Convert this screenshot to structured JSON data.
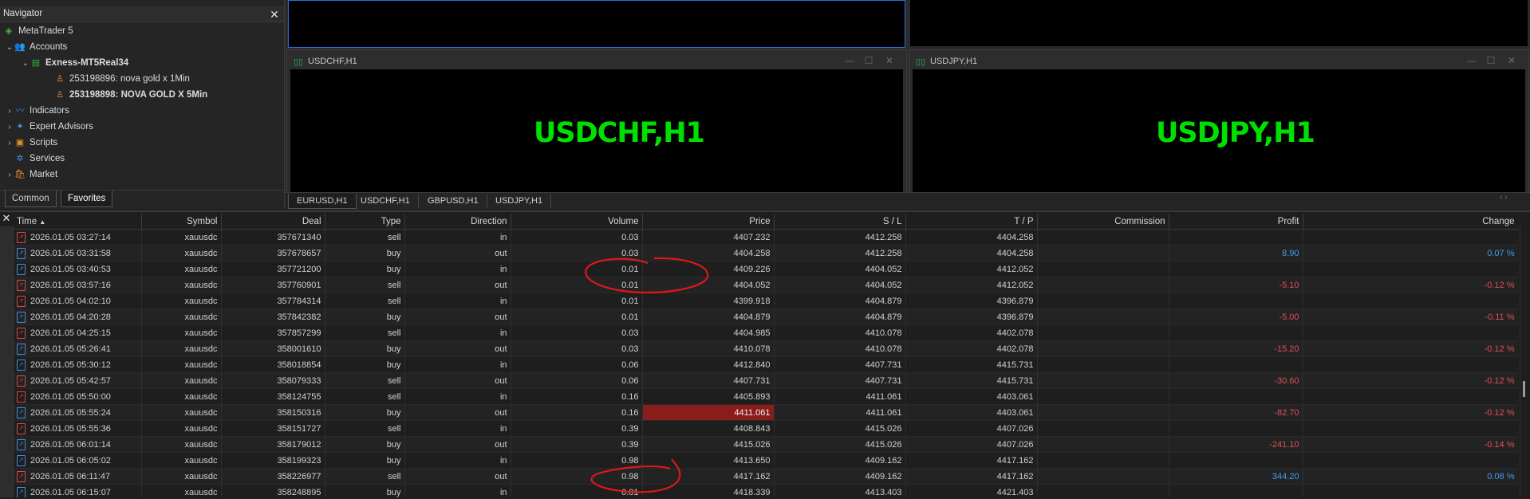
{
  "navigator": {
    "title": "Navigator",
    "items": [
      {
        "label": "MetaTrader 5",
        "icon": "metatrader-icon"
      },
      {
        "label": "Accounts",
        "icon": "accounts-icon"
      },
      {
        "label": "Exness-MT5Real34",
        "icon": "server-icon"
      },
      {
        "label": "253198896: nova gold x 1Min",
        "icon": "user-icon"
      },
      {
        "label": "253198898: NOVA GOLD X 5Min",
        "icon": "user-icon"
      },
      {
        "label": "Indicators",
        "icon": "indicators-icon"
      },
      {
        "label": "Expert Advisors",
        "icon": "expert-advisors-icon"
      },
      {
        "label": "Scripts",
        "icon": "scripts-icon"
      },
      {
        "label": "Services",
        "icon": "services-icon"
      },
      {
        "label": "Market",
        "icon": "market-icon"
      }
    ],
    "tabs": [
      "Common",
      "Favorites"
    ]
  },
  "charts": {
    "windows": [
      {
        "title": "USDCHF,H1",
        "label": "USDCHF,H1"
      },
      {
        "title": "USDJPY,H1",
        "label": "USDJPY,H1"
      }
    ],
    "tabs": [
      "EURUSD,H1",
      "USDCHF,H1",
      "GBPUSD,H1",
      "USDJPY,H1"
    ]
  },
  "deals": {
    "columns": [
      "Time",
      "Symbol",
      "Deal",
      "Type",
      "Direction",
      "Volume",
      "Price",
      "S / L",
      "T / P",
      "Commission",
      "Profit",
      "Change"
    ],
    "rows": [
      {
        "time": "2026.01.05 03:27:14",
        "symbol": "xauusdc",
        "deal": "357671340",
        "type": "sell",
        "direction": "in",
        "volume": "0.03",
        "price": "4407.232",
        "sl": "4412.258",
        "tp": "4404.258",
        "commission": "",
        "profit": "",
        "change": ""
      },
      {
        "time": "2026.01.05 03:31:58",
        "symbol": "xauusdc",
        "deal": "357678657",
        "type": "buy",
        "direction": "out",
        "volume": "0.03",
        "price": "4404.258",
        "sl": "4412.258",
        "tp": "4404.258",
        "commission": "",
        "profit": "8.90",
        "change": "0.07 %"
      },
      {
        "time": "2026.01.05 03:40:53",
        "symbol": "xauusdc",
        "deal": "357721200",
        "type": "buy",
        "direction": "in",
        "volume": "0.01",
        "price": "4409.226",
        "sl": "4404.052",
        "tp": "4412.052",
        "commission": "",
        "profit": "",
        "change": ""
      },
      {
        "time": "2026.01.05 03:57:16",
        "symbol": "xauusdc",
        "deal": "357760901",
        "type": "sell",
        "direction": "out",
        "volume": "0.01",
        "price": "4404.052",
        "sl": "4404.052",
        "tp": "4412.052",
        "commission": "",
        "profit": "-5.10",
        "change": "-0.12 %"
      },
      {
        "time": "2026.01.05 04:02:10",
        "symbol": "xauusdc",
        "deal": "357784314",
        "type": "sell",
        "direction": "in",
        "volume": "0.01",
        "price": "4399.918",
        "sl": "4404.879",
        "tp": "4396.879",
        "commission": "",
        "profit": "",
        "change": ""
      },
      {
        "time": "2026.01.05 04:20:28",
        "symbol": "xauusdc",
        "deal": "357842382",
        "type": "buy",
        "direction": "out",
        "volume": "0.01",
        "price": "4404.879",
        "sl": "4404.879",
        "tp": "4396.879",
        "commission": "",
        "profit": "-5.00",
        "change": "-0.11 %"
      },
      {
        "time": "2026.01.05 04:25:15",
        "symbol": "xauusdc",
        "deal": "357857299",
        "type": "sell",
        "direction": "in",
        "volume": "0.03",
        "price": "4404.985",
        "sl": "4410.078",
        "tp": "4402.078",
        "commission": "",
        "profit": "",
        "change": ""
      },
      {
        "time": "2026.01.05 05:26:41",
        "symbol": "xauusdc",
        "deal": "358001610",
        "type": "buy",
        "direction": "out",
        "volume": "0.03",
        "price": "4410.078",
        "sl": "4410.078",
        "tp": "4402.078",
        "commission": "",
        "profit": "-15.20",
        "change": "-0.12 %"
      },
      {
        "time": "2026.01.05 05:30:12",
        "symbol": "xauusdc",
        "deal": "358018854",
        "type": "buy",
        "direction": "in",
        "volume": "0.06",
        "price": "4412.840",
        "sl": "4407.731",
        "tp": "4415.731",
        "commission": "",
        "profit": "",
        "change": ""
      },
      {
        "time": "2026.01.05 05:42:57",
        "symbol": "xauusdc",
        "deal": "358079333",
        "type": "sell",
        "direction": "out",
        "volume": "0.06",
        "price": "4407.731",
        "sl": "4407.731",
        "tp": "4415.731",
        "commission": "",
        "profit": "-30.60",
        "change": "-0.12 %"
      },
      {
        "time": "2026.01.05 05:50:00",
        "symbol": "xauusdc",
        "deal": "358124755",
        "type": "sell",
        "direction": "in",
        "volume": "0.16",
        "price": "4405.893",
        "sl": "4411.061",
        "tp": "4403.061",
        "commission": "",
        "profit": "",
        "change": ""
      },
      {
        "time": "2026.01.05 05:55:24",
        "symbol": "xauusdc",
        "deal": "358150316",
        "type": "buy",
        "direction": "out",
        "volume": "0.16",
        "price": "4411.061",
        "sl": "4411.061",
        "tp": "4403.061",
        "commission": "",
        "profit": "-82.70",
        "change": "-0.12 %",
        "highlight_price": true
      },
      {
        "time": "2026.01.05 05:55:36",
        "symbol": "xauusdc",
        "deal": "358151727",
        "type": "sell",
        "direction": "in",
        "volume": "0.39",
        "price": "4408.843",
        "sl": "4415.026",
        "tp": "4407.026",
        "commission": "",
        "profit": "",
        "change": ""
      },
      {
        "time": "2026.01.05 06:01:14",
        "symbol": "xauusdc",
        "deal": "358179012",
        "type": "buy",
        "direction": "out",
        "volume": "0.39",
        "price": "4415.026",
        "sl": "4415.026",
        "tp": "4407.026",
        "commission": "",
        "profit": "-241.10",
        "change": "-0.14 %"
      },
      {
        "time": "2026.01.05 06:05:02",
        "symbol": "xauusdc",
        "deal": "358199323",
        "type": "buy",
        "direction": "in",
        "volume": "0.98",
        "price": "4413.650",
        "sl": "4409.162",
        "tp": "4417.162",
        "commission": "",
        "profit": "",
        "change": ""
      },
      {
        "time": "2026.01.05 06:11:47",
        "symbol": "xauusdc",
        "deal": "358226977",
        "type": "sell",
        "direction": "out",
        "volume": "0.98",
        "price": "4417.162",
        "sl": "4409.162",
        "tp": "4417.162",
        "commission": "",
        "profit": "344.20",
        "change": "0.08 %"
      },
      {
        "time": "2026.01.05 06:15:07",
        "symbol": "xauusdc",
        "deal": "358248895",
        "type": "buy",
        "direction": "in",
        "volume": "0.01",
        "price": "4418.339",
        "sl": "4413.403",
        "tp": "4421.403",
        "commission": "",
        "profit": "",
        "change": ""
      }
    ]
  },
  "colors": {
    "accent_green": "#00e000",
    "profit_positive": "#3f9cf0",
    "profit_negative": "#e05050",
    "highlight_cell": "#8b1c1c",
    "annotation": "#e01818"
  }
}
